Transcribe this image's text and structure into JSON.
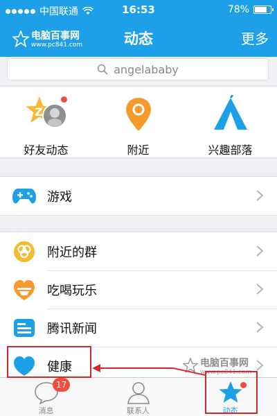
{
  "status_bar": {
    "carrier": "中国联通",
    "time": "16:53",
    "battery": "78%",
    "battery_level": 0.78
  },
  "header": {
    "title": "动态",
    "more": "更多",
    "logo_brand": "电脑百事网",
    "logo_url": "www.pc841.com"
  },
  "search": {
    "placeholder": "angelababy"
  },
  "quick_actions": [
    {
      "label": "好友动态",
      "icon": "friends-feed-icon"
    },
    {
      "label": "附近",
      "icon": "location-pin-icon"
    },
    {
      "label": "兴趣部落",
      "icon": "tent-icon"
    }
  ],
  "menu1": [
    {
      "label": "游戏",
      "icon": "gamepad-icon"
    }
  ],
  "menu2": [
    {
      "label": "附近的群",
      "icon": "nearby-group-icon"
    },
    {
      "label": "吃喝玩乐",
      "icon": "leisure-icon"
    },
    {
      "label": "腾讯新闻",
      "icon": "news-icon"
    },
    {
      "label": "健康",
      "icon": "heart-icon"
    }
  ],
  "tabbar": {
    "messages": {
      "label": "消息",
      "badge": "17"
    },
    "contacts": {
      "label": "联系人"
    },
    "feeds": {
      "label": "动态"
    }
  },
  "watermark": {
    "brand": "电脑百事网",
    "url": "www.pc841.com"
  },
  "colors": {
    "accent": "#1ea0e8",
    "highlight": "#d9262c",
    "badge": "#f24c3d"
  }
}
